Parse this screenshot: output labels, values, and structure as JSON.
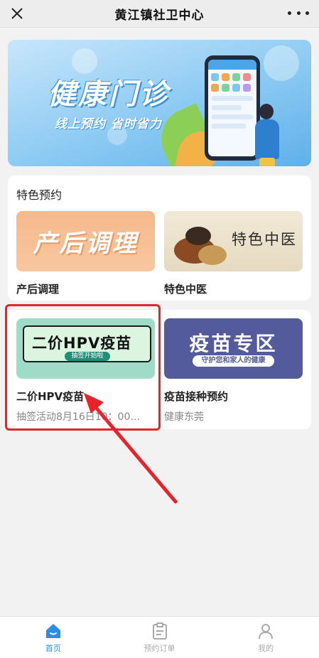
{
  "header": {
    "title": "黄江镇社卫中心"
  },
  "banner": {
    "title": "健康门诊",
    "subtitle": "线上预约 省时省力"
  },
  "featured": {
    "section_title": "特色预约",
    "items": [
      {
        "label": "产后调理",
        "thumb_text": "产后调理"
      },
      {
        "label": "特色中医",
        "thumb_text": "特色中医"
      }
    ]
  },
  "more": {
    "items": [
      {
        "label": "二价HPV疫苗",
        "sub": "抽签活动8月16日10：00…",
        "thumb_text": "二价HPV疫苗",
        "thumb_pill": "抽签开始啦"
      },
      {
        "label": "疫苗接种预约",
        "sub": "健康东莞",
        "thumb_text": "疫苗专区",
        "thumb_band": "守护您和家人的健康"
      }
    ]
  },
  "tabs": [
    {
      "label": "首页",
      "icon": "home-icon",
      "active": true
    },
    {
      "label": "预约订单",
      "icon": "clipboard-icon",
      "active": false
    },
    {
      "label": "我的",
      "icon": "person-icon",
      "active": false
    }
  ],
  "colors": {
    "accent": "#2b8de8",
    "highlight": "#e8242a"
  }
}
